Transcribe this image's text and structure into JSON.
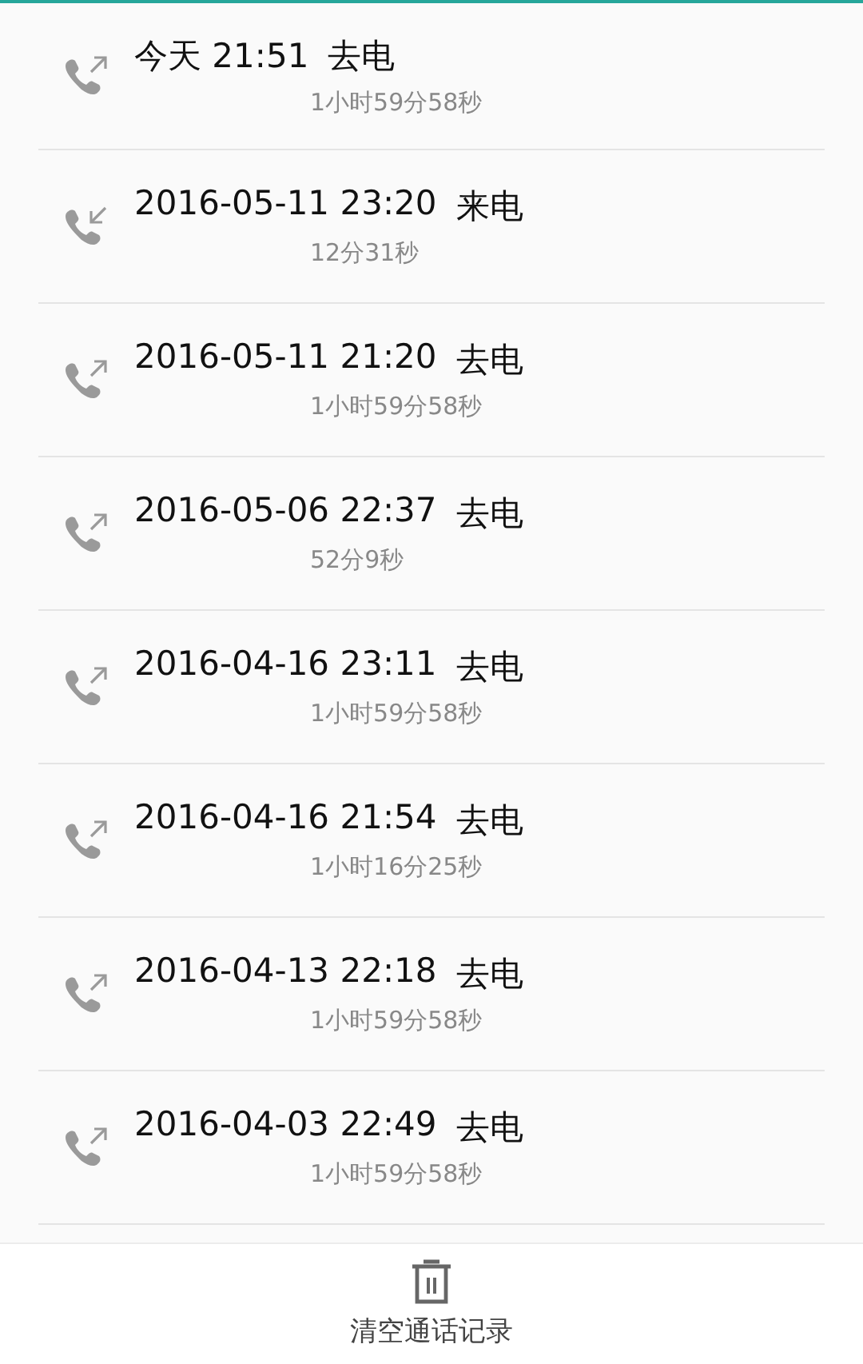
{
  "calls": [
    {
      "kind": "outgoing",
      "time": "今天 21:51",
      "label": "去电",
      "detail": "1小时59分58秒"
    },
    {
      "kind": "incoming",
      "time": "2016-05-11 23:20",
      "label": "来电",
      "detail": "12分31秒"
    },
    {
      "kind": "outgoing",
      "time": "2016-05-11 21:20",
      "label": "去电",
      "detail": "1小时59分58秒"
    },
    {
      "kind": "outgoing",
      "time": "2016-05-06 22:37",
      "label": "去电",
      "detail": "52分9秒"
    },
    {
      "kind": "outgoing",
      "time": "2016-04-16 23:11",
      "label": "去电",
      "detail": "1小时59分58秒"
    },
    {
      "kind": "outgoing",
      "time": "2016-04-16 21:54",
      "label": "去电",
      "detail": "1小时16分25秒"
    },
    {
      "kind": "outgoing",
      "time": "2016-04-13 22:18",
      "label": "去电",
      "detail": "1小时59分58秒"
    },
    {
      "kind": "outgoing",
      "time": "2016-04-03 22:49",
      "label": "去电",
      "detail": "1小时59分58秒"
    }
  ],
  "clear_button": {
    "label": "清空通话记录"
  }
}
